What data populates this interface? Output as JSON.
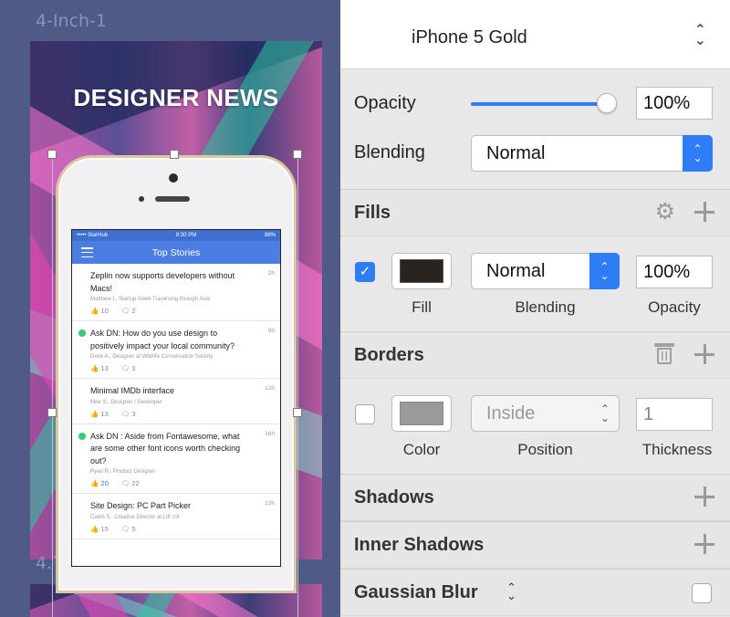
{
  "canvas": {
    "artboards": [
      {
        "label": "4-Inch-1"
      },
      {
        "label": "4.7-Inch-1"
      }
    ],
    "headline": "DESIGNER NEWS",
    "app": {
      "status_left": "••••• StarHub",
      "status_time": "8:30 PM",
      "status_right": "88%",
      "nav_title": "Top Stories",
      "stories": [
        {
          "title": "Zeplin now supports developers without Macs!",
          "age": "2h",
          "meta": "Matthew I., Startup Geek Traversing through Asia",
          "likes": "10",
          "comments": "2",
          "dn": false,
          "liked": false
        },
        {
          "title": "Ask DN: How do you use design to positively impact your local community?",
          "age": "9h",
          "meta": "Drew A., Designer at Wildlife Conservation Society",
          "likes": "13",
          "comments": "3",
          "dn": true,
          "liked": false
        },
        {
          "title": "Minimal IMDb interface",
          "age": "12h",
          "meta": "Moe S., Designer / Developer",
          "likes": "13",
          "comments": "3",
          "dn": false,
          "liked": false
        },
        {
          "title": "Ask DN : Aside from Fontawesome, what are some other font icons worth checking out?",
          "age": "16h",
          "meta": "Ryan R., Product Designer",
          "likes": "20",
          "comments": "22",
          "dn": true,
          "liked": true
        },
        {
          "title": "Site Design: PC Part Picker",
          "age": "13h",
          "meta": "Caleb S., Creative Director at Lift UX",
          "likes": "15",
          "comments": "5",
          "dn": false,
          "liked": false
        }
      ]
    }
  },
  "inspector": {
    "device": "iPhone 5 Gold",
    "opacity_label": "Opacity",
    "opacity_value": "100%",
    "opacity_fraction": 1.0,
    "blending_label": "Blending",
    "blending_value": "Normal",
    "fills": {
      "title": "Fills",
      "checked": true,
      "blending_value": "Normal",
      "opacity_value": "100%",
      "fill_caption": "Fill",
      "blending_caption": "Blending",
      "opacity_caption": "Opacity",
      "swatch_color": "#2a2420"
    },
    "borders": {
      "title": "Borders",
      "checked": false,
      "position_value": "Inside",
      "thickness_value": "1",
      "color_caption": "Color",
      "position_caption": "Position",
      "thickness_caption": "Thickness",
      "swatch_color": "#9a9a9a"
    },
    "shadows_title": "Shadows",
    "inner_shadows_title": "Inner Shadows",
    "gaussian_blur_title": "Gaussian Blur"
  },
  "colors": {
    "accent": "#2e7cf6",
    "canvas_bg": "#4f5a86",
    "app_blue": "#4b7ee0",
    "dn_green": "#3ec77b"
  }
}
